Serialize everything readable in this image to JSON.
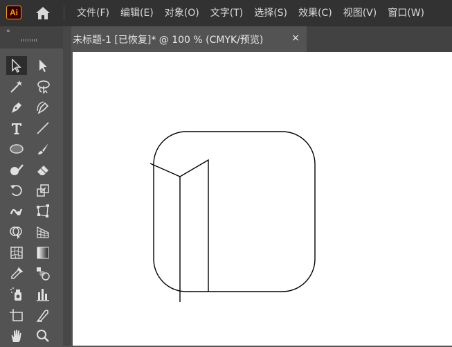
{
  "app": {
    "logo_text": "Ai",
    "logo_color": "#ff9a00"
  },
  "menu": {
    "items": [
      {
        "label": "文件(F)"
      },
      {
        "label": "编辑(E)"
      },
      {
        "label": "对象(O)"
      },
      {
        "label": "文字(T)"
      },
      {
        "label": "选择(S)"
      },
      {
        "label": "效果(C)"
      },
      {
        "label": "视图(V)"
      },
      {
        "label": "窗口(W)"
      }
    ]
  },
  "toolbar": {
    "collapse_label": "«",
    "tools": [
      {
        "name": "selection-tool",
        "icon": "arrow-icon"
      },
      {
        "name": "direct-selection-tool",
        "icon": "white-arrow-icon"
      },
      {
        "name": "magic-wand-tool",
        "icon": "magic-wand-icon"
      },
      {
        "name": "lasso-tool",
        "icon": "lasso-icon"
      },
      {
        "name": "pen-tool",
        "icon": "pen-icon"
      },
      {
        "name": "curvature-tool",
        "icon": "curvature-pen-icon"
      },
      {
        "name": "type-tool",
        "icon": "type-icon"
      },
      {
        "name": "line-tool",
        "icon": "line-icon"
      },
      {
        "name": "ellipse-tool",
        "icon": "ellipse-icon"
      },
      {
        "name": "paintbrush-tool",
        "icon": "brush-icon"
      },
      {
        "name": "shaper-tool",
        "icon": "shaper-icon"
      },
      {
        "name": "eraser-tool",
        "icon": "eraser-icon"
      },
      {
        "name": "rotate-tool",
        "icon": "rotate-icon"
      },
      {
        "name": "scale-tool",
        "icon": "scale-icon"
      },
      {
        "name": "warp-tool",
        "icon": "warp-icon"
      },
      {
        "name": "free-transform-tool",
        "icon": "free-transform-icon"
      },
      {
        "name": "shape-builder-tool",
        "icon": "shape-builder-icon"
      },
      {
        "name": "perspective-grid-tool",
        "icon": "perspective-icon"
      },
      {
        "name": "mesh-tool",
        "icon": "mesh-icon"
      },
      {
        "name": "gradient-tool",
        "icon": "gradient-icon"
      },
      {
        "name": "eyedropper-tool",
        "icon": "eyedropper-icon"
      },
      {
        "name": "blend-tool",
        "icon": "blend-icon"
      },
      {
        "name": "symbol-sprayer-tool",
        "icon": "spray-icon"
      },
      {
        "name": "column-graph-tool",
        "icon": "bar-graph-icon"
      },
      {
        "name": "artboard-tool",
        "icon": "artboard-icon"
      },
      {
        "name": "slice-tool",
        "icon": "knife-icon"
      },
      {
        "name": "hand-tool",
        "icon": "hand-icon"
      },
      {
        "name": "zoom-tool",
        "icon": "magnifier-icon"
      }
    ]
  },
  "document": {
    "tab_title": "未标题-1 [已恢复]* @ 100 % (CMYK/预览)",
    "close_label": "×"
  }
}
